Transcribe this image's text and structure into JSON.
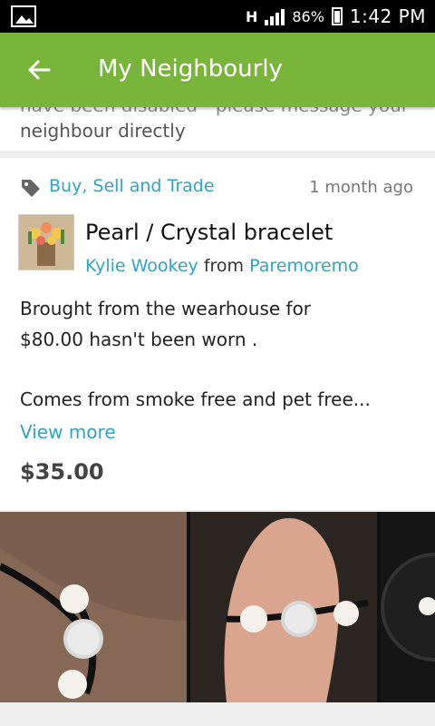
{
  "status_bar": {
    "network_h": "H",
    "battery_percent": "86%",
    "time": "1:42 PM"
  },
  "app_bar": {
    "title": "My Neighbourly"
  },
  "notice": {
    "text_top": "have been disabled - please message your",
    "text": "neighbour directly"
  },
  "listing": {
    "category": "Buy, Sell and Trade",
    "time_ago": "1 month ago",
    "title": "Pearl / Crystal   bracelet",
    "author": "Kylie Wookey",
    "from_word": "from",
    "location": "Paremoremo",
    "description_line1": "Brought from the wearhouse for",
    "description_line2": "$80.00 hasn't been worn .",
    "description_line3": "Comes from smoke free and pet free...",
    "view_more": "View more",
    "price": "$35.00"
  },
  "icons": {
    "back": "back-arrow-icon",
    "tag": "tag-icon",
    "gallery_status": "image-icon"
  }
}
